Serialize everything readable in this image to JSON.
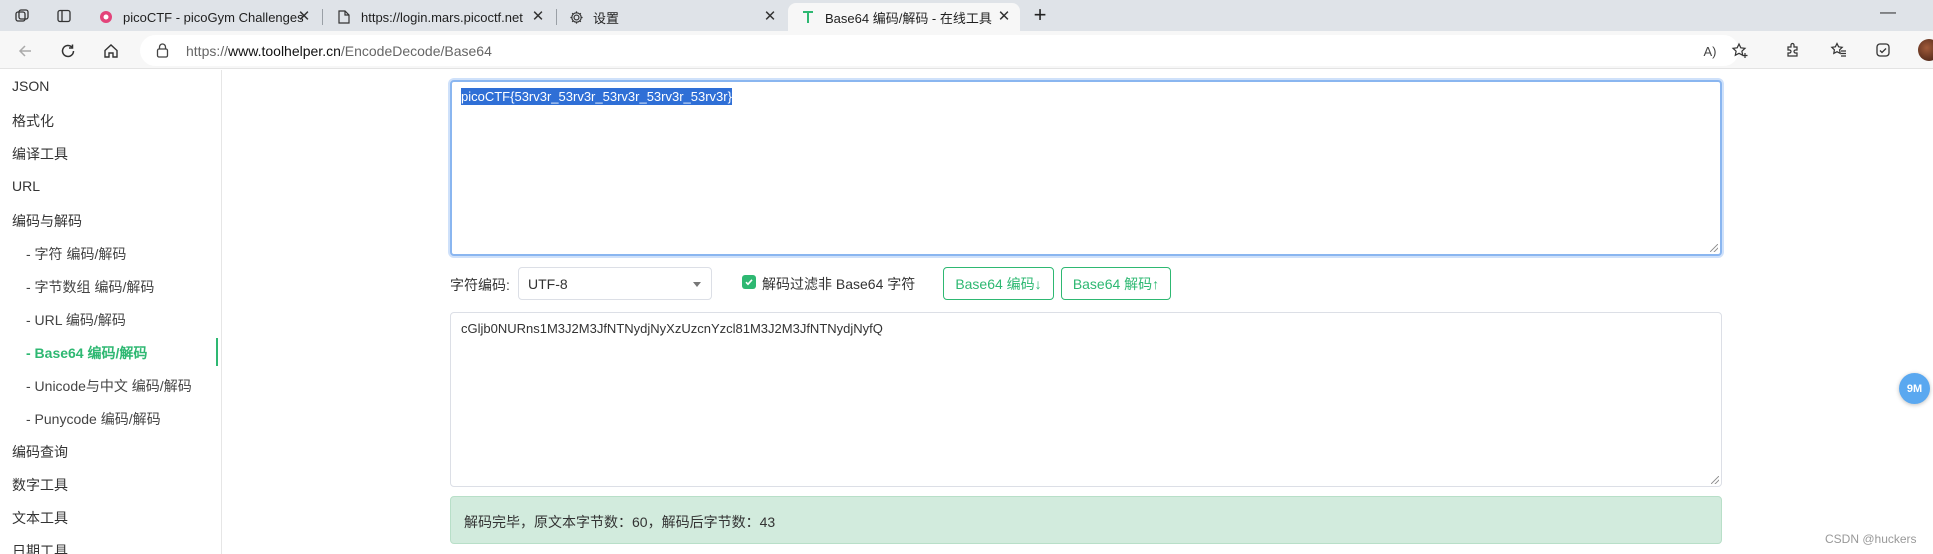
{
  "browser": {
    "tabs": [
      {
        "label": "picoCTF - picoGym Challenges",
        "icon": "picoctf-favicon",
        "close": "✕"
      },
      {
        "label": "https://login.mars.picoctf.net",
        "icon": "page-icon",
        "close": "✕"
      },
      {
        "label": "设置",
        "icon": "gear-icon",
        "close": "✕"
      },
      {
        "label": "Base64 编码/解码 - 在线工具",
        "icon": "toolhelper-favicon",
        "close": "✕",
        "active": true
      }
    ],
    "new_tab": "+",
    "minimize": "—",
    "url_prefix": "https://",
    "url_host": "www.toolhelper.cn",
    "url_path": "/EncodeDecode/Base64",
    "read_aloud": "A)"
  },
  "sidebar": {
    "items": [
      {
        "label": "JSON"
      },
      {
        "label": "格式化"
      },
      {
        "label": "编译工具"
      },
      {
        "label": "URL"
      },
      {
        "label": "编码与解码"
      },
      {
        "label": "- 字符  编码/解码"
      },
      {
        "label": "- 字节数组  编码/解码"
      },
      {
        "label": "- URL  编码/解码"
      },
      {
        "label": "- Base64  编码/解码"
      },
      {
        "label": "- Unicode与中文  编码/解码"
      },
      {
        "label": "- Punycode  编码/解码"
      },
      {
        "label": "编码查询"
      },
      {
        "label": "数字工具"
      },
      {
        "label": "文本工具"
      },
      {
        "label": "日期工具"
      }
    ]
  },
  "main": {
    "input_text": "picoCTF{53rv3r_53rv3r_53rv3r_53rv3r_53rv3r}",
    "charset_label": "字符编码:",
    "charset_value": "UTF-8",
    "filter_checked": true,
    "filter_label": "解码过滤非 Base64 字符",
    "encode_button": "Base64 编码↓",
    "decode_button": "Base64 解码↑",
    "output_text": "cGljb0NURns1M3J2M3JfNTNydjNyXzUzcnYzcl81M3J2M3JfNTNydjNyfQ",
    "status_text": "解码完毕，原文本字节数：60，解码后字节数：43"
  },
  "floating_badge": "9M",
  "watermark": "CSDN @huckers",
  "colors": {
    "accent_green": "#2eb872",
    "status_bg": "#d2ebdd",
    "selection_blue": "#2f6fd6",
    "focus_border": "#8ab6f0"
  }
}
